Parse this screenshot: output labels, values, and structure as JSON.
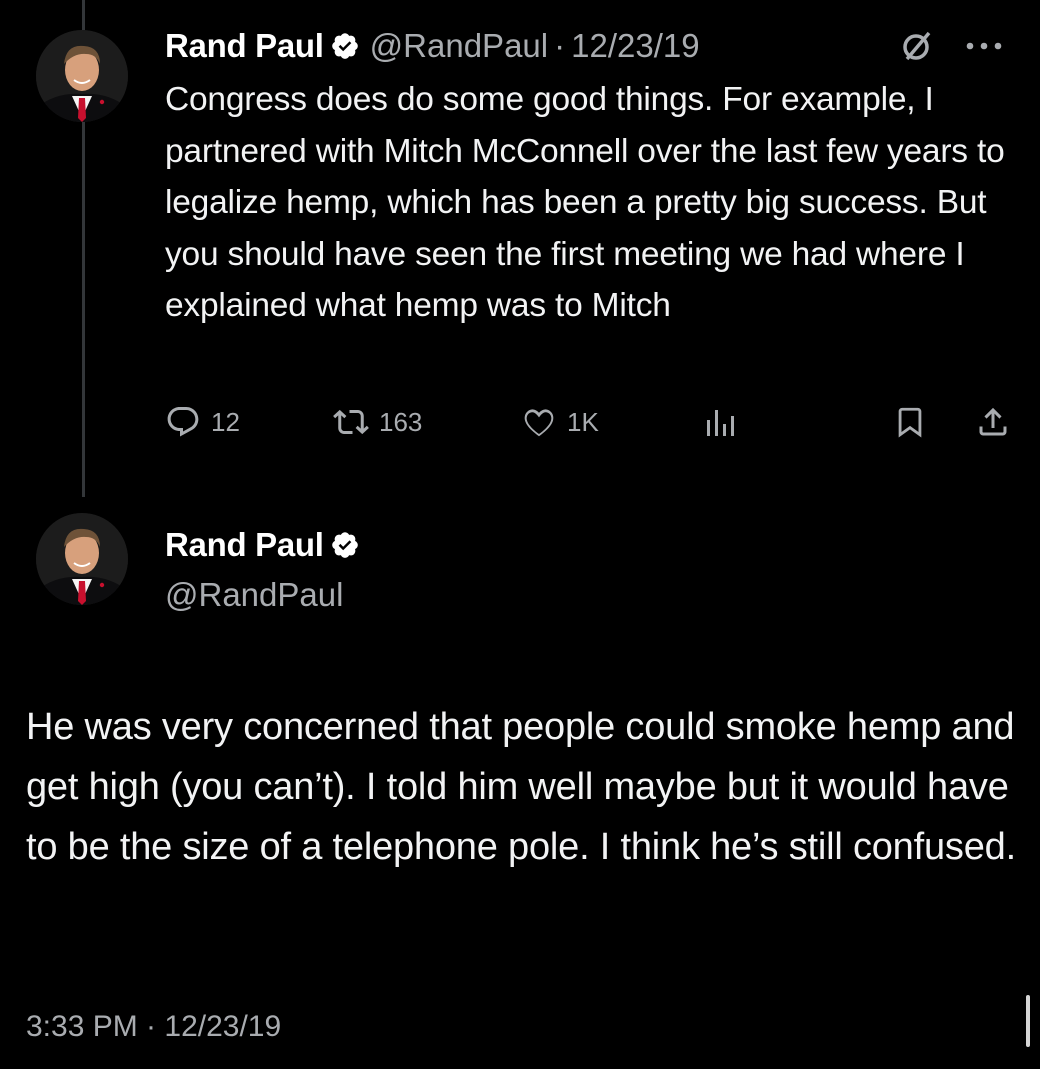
{
  "colors": {
    "background": "#000000",
    "text_primary": "#e7e9ea",
    "text_secondary": "#a9acb0",
    "verified_badge": "#1d9bf0",
    "thread_line": "#333639"
  },
  "tweet1": {
    "name": "Rand Paul",
    "handle": "@RandPaul",
    "separator": "·",
    "date": "12/23/19",
    "body": "Congress does do some good things. For example, I partnered with Mitch McConnell over the last few years to legalize hemp, which has been a pretty big success. But you should have seen the first meeting we had where I explained what hemp was to Mitch",
    "header_icons": [
      "grok-icon",
      "more-icon"
    ],
    "actions": {
      "replies": "12",
      "reposts": "163",
      "likes": "1K"
    },
    "action_icons": [
      "reply-icon",
      "repost-icon",
      "like-icon",
      "views-icon",
      "bookmark-icon",
      "share-icon"
    ]
  },
  "tweet2": {
    "name": "Rand Paul",
    "handle": "@RandPaul",
    "body": "He was very concerned that people could smoke hemp and get high (you can’t). I told him well maybe but it would have to be the size of a telephone pole. I think he’s still confused.",
    "timestamp": "3:33 PM · 12/23/19"
  }
}
